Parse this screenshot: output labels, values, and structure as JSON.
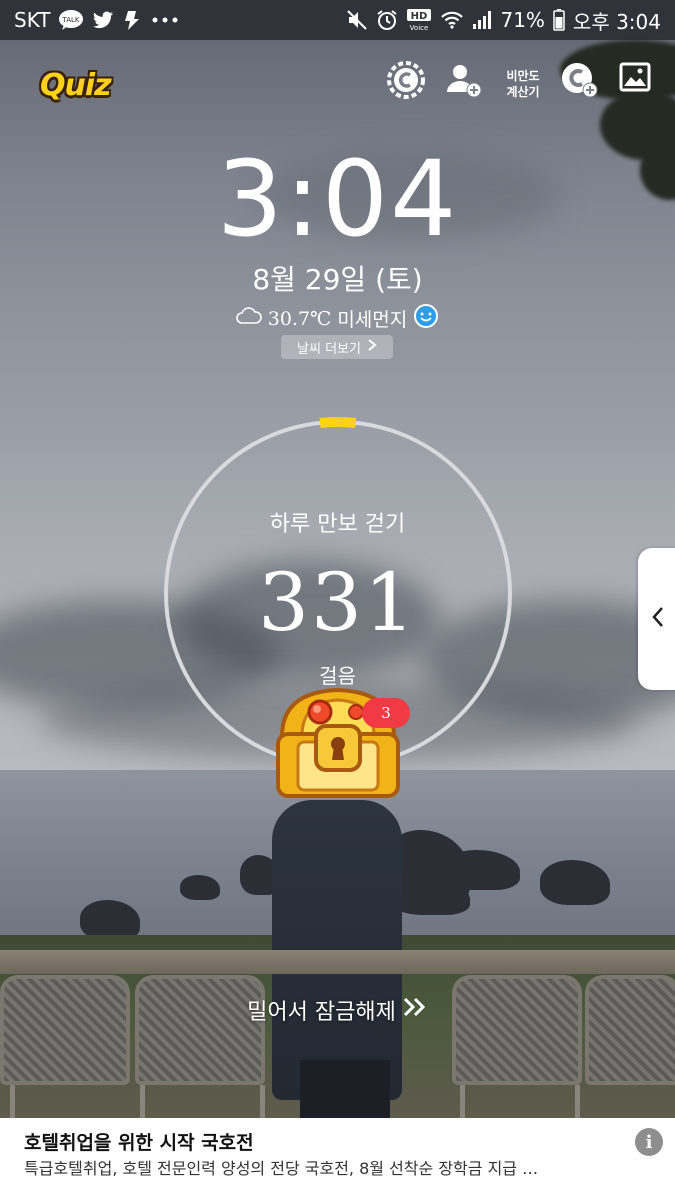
{
  "status_bar": {
    "carrier": "SKT",
    "talk_badge": "TALK",
    "hd_badge": "HD",
    "hd_sub": "Voice",
    "battery": "71%",
    "time": "오후 3:04",
    "icons": [
      "kakaotalk-icon",
      "twitter-icon",
      "app-icon",
      "more-dots-icon",
      "mute-icon",
      "alarm-icon",
      "hd-voice-icon",
      "wifi-icon",
      "signal-icon",
      "battery-icon"
    ]
  },
  "top_bar": {
    "quiz_label": "Quiz",
    "calc_label_line1": "비만도",
    "calc_label_line2": "계산기",
    "icons": [
      "coin-icon",
      "add-user-icon",
      "cash-add-icon",
      "gallery-icon"
    ]
  },
  "lock": {
    "clock": "3:04",
    "date": "8월 29일 (토)",
    "temperature": "30.7℃",
    "dust_label": "미세먼지",
    "dust_status_icon": "smile-face-icon",
    "weather_more": "날씨 더보기"
  },
  "steps": {
    "title": "하루 만보 걷기",
    "count": "331",
    "unit": "걸음",
    "goal_fraction": 0.0331
  },
  "chest": {
    "badge": "3"
  },
  "unlock_text": "밀어서 잠금해제",
  "ad": {
    "title": "호텔취업을 위한 시작 국호전",
    "description": "특급호텔취업, 호텔 전문인력 양성의 전당 국호전, 8월 선착순 장학금 지급 …",
    "info": "i"
  },
  "colors": {
    "accent_yellow": "#ffd21a",
    "badge_red": "#f23a45",
    "ring_track": "#d9dadd"
  }
}
